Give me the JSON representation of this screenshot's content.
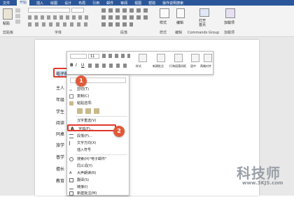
{
  "tabs": [
    "文件",
    "开始",
    "插入",
    "绘图",
    "设计",
    "布局",
    "引用",
    "邮件",
    "审阅",
    "视图",
    "帮助",
    "操作说明搜索"
  ],
  "ribbon": {
    "groups": [
      "剪贴板",
      "字体",
      "段落",
      "样式",
      "编辑",
      "Commands Group",
      "加载项"
    ],
    "paste_label": "粘贴",
    "styles_label": "样式",
    "edit_label": "编辑",
    "open_label": "打开",
    "home_label": "首页",
    "addin_label": "加载项"
  },
  "mini_toolbar": {
    "font_size": "11",
    "buttons": [
      "样式",
      "新建批注",
      "行和段落间距",
      "居中",
      "两端对齐"
    ],
    "b": "B",
    "i": "I",
    "u": "U"
  },
  "document": {
    "fields": [
      "电子邮件",
      "主人",
      "年级",
      "学生",
      "阅读",
      "同桌",
      "旅学",
      "普学",
      "擅长",
      "教育"
    ]
  },
  "context_menu": {
    "search": "",
    "items": [
      "剪切(T)",
      "复制(C)",
      "粘贴选项:",
      "",
      "汉字重选(V)",
      "字体(F)...",
      "段落(P)...",
      "文字方向(X)",
      "插入符号",
      "搜索(H)\"电子邮件\"",
      "同义词(Y)",
      "大声朗读(R)",
      "翻译(S)",
      "链接(I)",
      "新建批注(M)"
    ]
  },
  "badges": [
    "1",
    "2"
  ],
  "watermark": {
    "text": "科技师",
    "url": "www.3KJS.com"
  },
  "colors": {
    "accent": "#2b579a",
    "badge": "#e05a3a",
    "highlight": "#e0392b"
  }
}
